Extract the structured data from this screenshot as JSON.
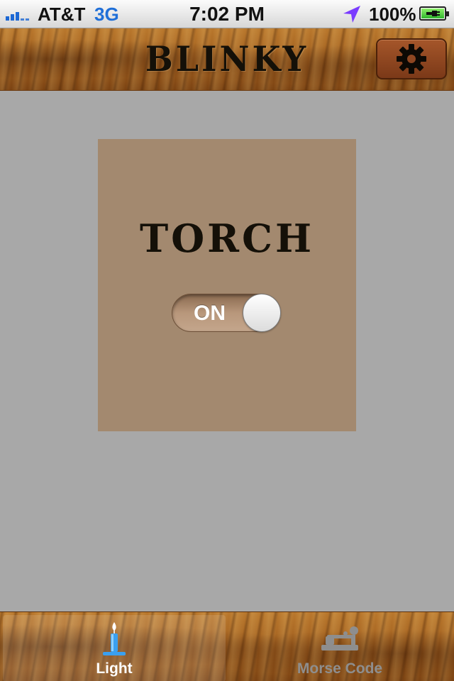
{
  "status_bar": {
    "carrier": "AT&T",
    "network": "3G",
    "time": "7:02 PM",
    "battery_percent": "100%",
    "icons": [
      "signal-icon",
      "location-arrow-icon",
      "battery-charging-icon"
    ]
  },
  "nav": {
    "title": "BLINKY",
    "settings_icon": "gear-icon"
  },
  "torch": {
    "title": "TORCH",
    "toggle_label": "ON",
    "toggle_on": true
  },
  "tabs": [
    {
      "label": "Light",
      "icon": "candle-icon",
      "selected": true
    },
    {
      "label": "Morse Code",
      "icon": "telegraph-key-icon",
      "selected": false
    }
  ],
  "colors": {
    "accent_tab_icon": "#3aa0f0",
    "card_background": "#a3896f",
    "content_background": "#a8a8a8",
    "network_text": "#1f6fd8"
  }
}
